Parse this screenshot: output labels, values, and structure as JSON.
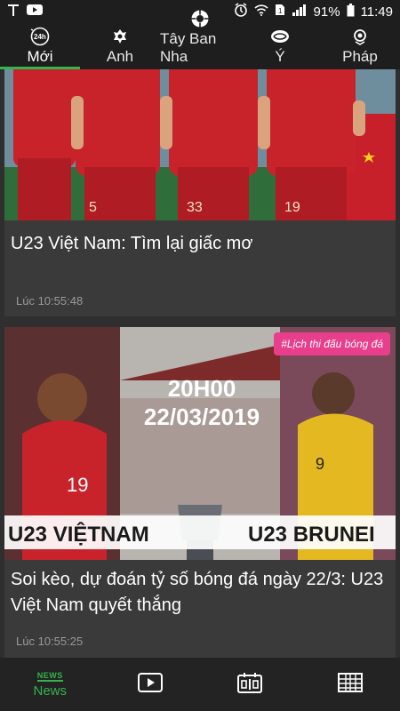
{
  "status_bar": {
    "battery": "91%",
    "time": "11:49"
  },
  "tabs": [
    {
      "label": "Mới",
      "icon": "24h-icon",
      "active": true
    },
    {
      "label": "Anh",
      "icon": "premier-league-icon"
    },
    {
      "label": "Tây Ban Nha",
      "icon": "laliga-icon"
    },
    {
      "label": "Ý",
      "icon": "serie-a-icon"
    },
    {
      "label": "Pháp",
      "icon": "ligue1-icon"
    }
  ],
  "articles": [
    {
      "title": "U23 Việt Nam: Tìm lại giấc mơ",
      "time": "Lúc 10:55:48"
    },
    {
      "title": "Soi kèo, dự đoán tỷ số bóng đá ngày 22/3: U23 Việt Nam quyết thắng",
      "time": "Lúc 10:55:25",
      "tag": "#Lịch thi đấu bóng đá",
      "image_text": {
        "kickoff": "20H00",
        "date": "22/03/2019",
        "team_left": "U23 VIỆTNAM",
        "team_right": "U23 BRUNEI"
      }
    }
  ],
  "badge_text": "24h",
  "bottom_nav": {
    "news_badge": "NEWS",
    "news_label": "News"
  },
  "colors": {
    "accent": "#36b34a",
    "background": "#2b2b2b",
    "card": "#3a3a3a",
    "tag": "#e83e8c"
  }
}
